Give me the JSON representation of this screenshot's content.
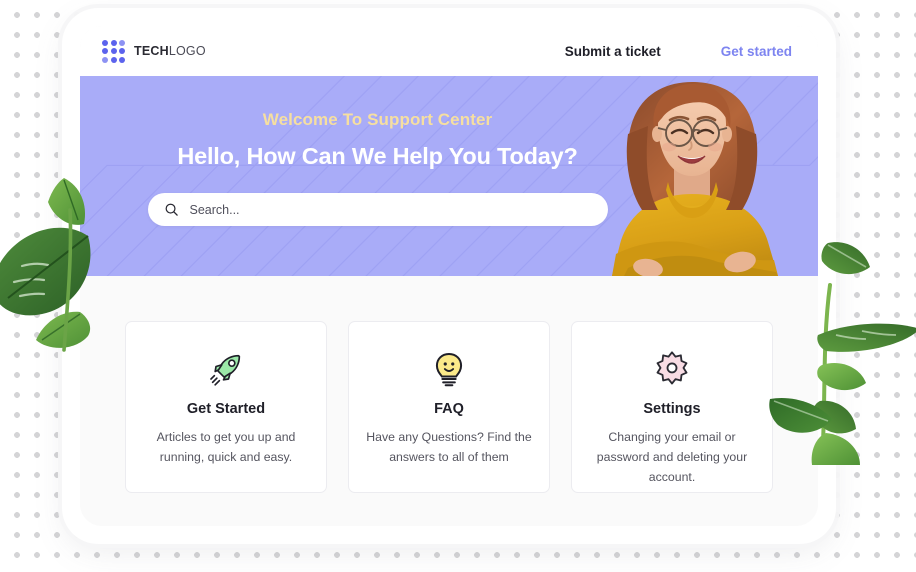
{
  "brand": {
    "name_bold": "TECH",
    "name_light": "LOGO",
    "logo_icon": "nine-dot-grid-logo",
    "dot_color": "#5c63ed"
  },
  "nav": {
    "submit_ticket": "Submit a ticket",
    "get_started": "Get started",
    "accent_color": "#7d84f0"
  },
  "hero": {
    "eyebrow": "Welcome To Support Center",
    "title": "Hello, How Can We Help You Today?",
    "background_color": "#a9acf8",
    "eyebrow_color": "#f6dfa0",
    "photo_alt": "smiling-woman-glasses-yellow-turtleneck"
  },
  "search": {
    "placeholder": "Search...",
    "value": "",
    "icon": "search-icon"
  },
  "cards": [
    {
      "icon": "rocket-icon",
      "icon_color": "#9be8a8",
      "title": "Get Started",
      "desc": "Articles to get you up and running, quick and easy."
    },
    {
      "icon": "lightbulb-smiley-icon",
      "icon_color": "#fbe98a",
      "title": "FAQ",
      "desc": "Have any Questions? Find the answers to all of them"
    },
    {
      "icon": "gear-icon",
      "icon_color": "#f8dce4",
      "title": "Settings",
      "desc": "Changing your email or password and deleting your account."
    }
  ],
  "decor": {
    "dot_grid_color": "#d4d4d6",
    "plant_left": "monstera-leaf-left",
    "plant_right": "monstera-plant-right",
    "plant_top_right": "monstera-leaf-top-right"
  }
}
